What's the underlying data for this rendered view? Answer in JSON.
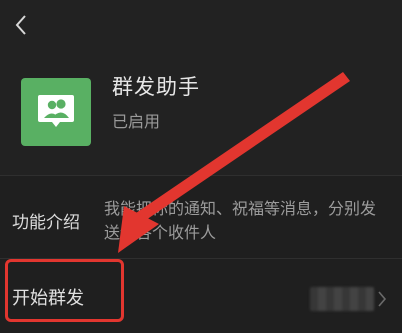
{
  "header": {
    "back_icon": "chevron-left-icon"
  },
  "app": {
    "name": "群发助手",
    "status": "已启用",
    "icon": "group-message-icon",
    "icon_color": "#59b063"
  },
  "intro": {
    "label": "功能介绍",
    "text": "我能把你的通知、祝福等消息，分别发送给各个收件人"
  },
  "action": {
    "label": "开始群发",
    "chevron_icon": "chevron-right-icon"
  },
  "annotations": {
    "highlight_color": "#e2362f",
    "arrow_color": "#e2362f"
  }
}
